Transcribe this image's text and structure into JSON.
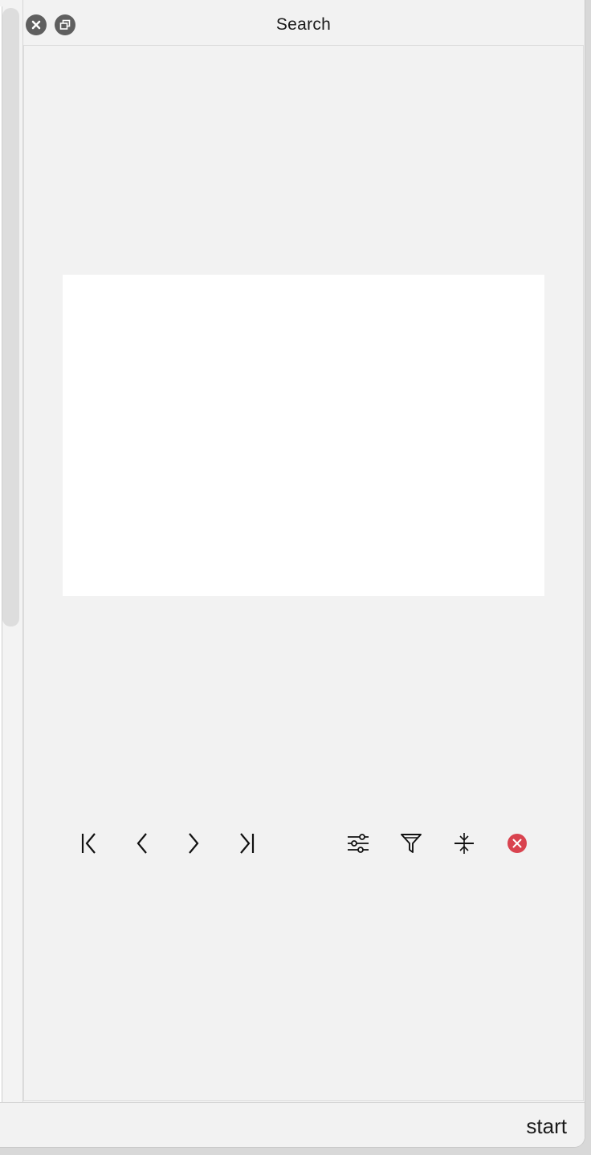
{
  "window": {
    "title": "Search"
  },
  "titlebar": {
    "close_icon": "close-circle-icon",
    "restore_icon": "restore-window-icon"
  },
  "toolbar": {
    "buttons": [
      {
        "name": "first",
        "icon": "first-page-icon"
      },
      {
        "name": "previous",
        "icon": "chevron-left-icon"
      },
      {
        "name": "next",
        "icon": "chevron-right-icon"
      },
      {
        "name": "last",
        "icon": "last-page-icon"
      },
      {
        "name": "options",
        "icon": "sliders-icon"
      },
      {
        "name": "filter",
        "icon": "filter-icon"
      },
      {
        "name": "collapse",
        "icon": "collapse-icon"
      },
      {
        "name": "cancel",
        "icon": "cancel-circle-icon"
      }
    ],
    "cancel_color": "#d9434f"
  },
  "footer": {
    "status": "start"
  }
}
